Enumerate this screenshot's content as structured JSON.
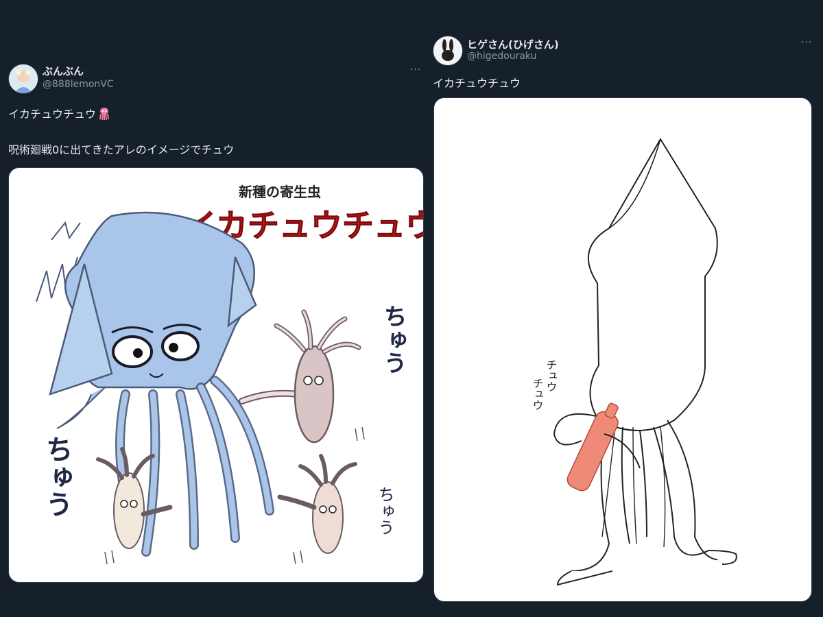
{
  "tweets": [
    {
      "display_name": "ぶんぶん",
      "handle": "@888lemonVC",
      "more_label": "···",
      "line1": "イカチュウチュウ",
      "line1_emoji": "squid-emoji",
      "line2": "呪術廻戦0に出てきたアレのイメージでチュウ",
      "media": {
        "subtitle": "新種の寄生虫",
        "title": "イカチュウチュウ",
        "sound_big_left": "ちゅう",
        "sound_right": "ちゅう",
        "sound_small": "ちゅう",
        "title_color": "#d4161c",
        "squid_color": "#a9c6ea"
      }
    },
    {
      "display_name": "ヒゲさん(ひげさん)",
      "handle": "@higedouraku",
      "more_label": "···",
      "line1": "イカチュウチュウ",
      "media": {
        "sound_1": "チュウ",
        "sound_2": "チュウ",
        "bottle_color": "#f08a78"
      }
    }
  ]
}
